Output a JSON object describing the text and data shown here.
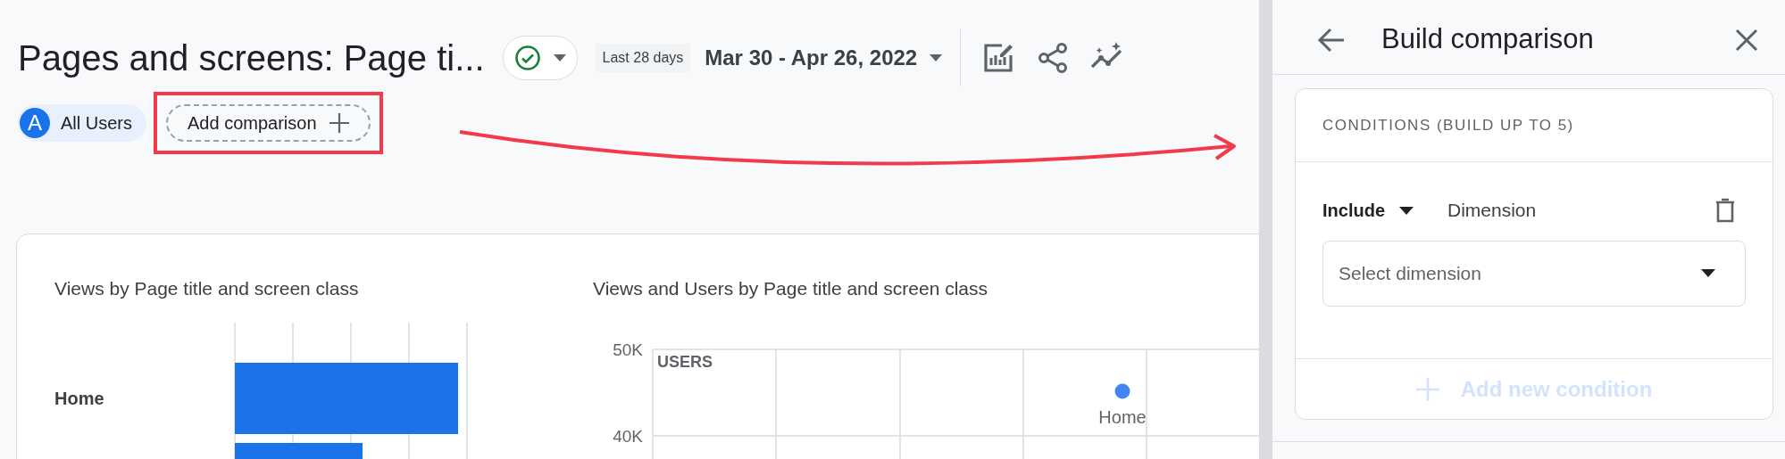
{
  "header": {
    "title": "Pages and screens: Page ti...",
    "date_chip": "Last 28 days",
    "date_range": "Mar 30 - Apr 26, 2022"
  },
  "comparisons": [
    {
      "kind": "segment",
      "avatar": "A",
      "label": "All Users",
      "highlighted": false
    },
    {
      "kind": "add",
      "label": "Add comparison",
      "highlighted": true
    }
  ],
  "charts": [
    {
      "kind": "bars",
      "title": "Views by Page title and screen class",
      "row_labels": [
        "Home"
      ]
    },
    {
      "kind": "scatter",
      "title": "Views and Users by Page title and screen class",
      "axis_title": "USERS",
      "y_tick_labels": [
        "50K",
        "40K"
      ],
      "point_labels": [
        "Home"
      ]
    }
  ],
  "panel": {
    "title": "Build comparison",
    "section": "CONDITIONS (BUILD UP TO 5)",
    "conditions": [
      {
        "mode": "Include",
        "field": "Dimension",
        "placeholder": "Select dimension"
      }
    ],
    "add_button": {
      "label": "Add new condition",
      "disabled": true
    }
  }
}
